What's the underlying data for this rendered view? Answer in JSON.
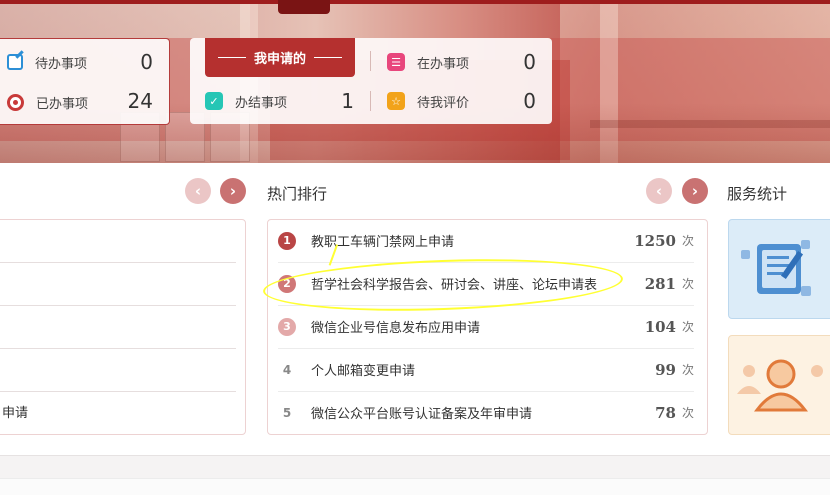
{
  "stats_left": {
    "pending": {
      "label": "待办事项",
      "value": "0",
      "icon": "edit-icon",
      "color": "#2c8fd6"
    },
    "handled": {
      "label": "已办事项",
      "value": "24",
      "icon": "target-icon",
      "color": "#c83a3a"
    }
  },
  "my_apply": {
    "tab_label": "我申请的",
    "completed": {
      "label": "办结事项",
      "value": "1",
      "icon": "check-circle-icon",
      "color": "#26c6b5"
    },
    "in_progress": {
      "label": "在办事项",
      "value": "0",
      "icon": "list-icon",
      "color": "#e8467c"
    },
    "to_review": {
      "label": "待我评价",
      "value": "0",
      "icon": "star-icon",
      "color": "#f2a31a"
    }
  },
  "hot_ranking": {
    "title": "热门排行",
    "unit": "次",
    "items": [
      {
        "rank": "1",
        "title": "教职工车辆门禁网上申请",
        "count": "1250",
        "badge_color": "#b94545"
      },
      {
        "rank": "2",
        "title": "哲学社会科学报告会、研讨会、讲座、论坛申请表",
        "count": "281",
        "badge_color": "#d07777"
      },
      {
        "rank": "3",
        "title": "微信企业号信息发布应用申请",
        "count": "104",
        "badge_color": "#e3a9a9"
      },
      {
        "rank": "4",
        "title": "个人邮箱变更申请",
        "count": "99",
        "badge_color": ""
      },
      {
        "rank": "5",
        "title": "微信公众平台账号认证备案及年审申请",
        "count": "78",
        "badge_color": ""
      }
    ]
  },
  "left_panel": {
    "tail_text": "申请"
  },
  "service_stats": {
    "title": "服务统计"
  },
  "nav": {
    "prev": "‹",
    "next": "›"
  }
}
